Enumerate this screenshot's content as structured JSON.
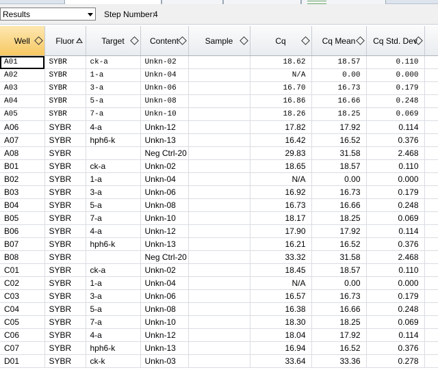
{
  "toolbar": {
    "view_selected": "Results",
    "step_label": "Step Number:",
    "step_value": "4"
  },
  "columns": [
    "Well",
    "Fluor",
    "Target",
    "Content",
    "Sample",
    "Cq",
    "Cq Mean",
    "Cq Std. Dev"
  ],
  "sorted_column": "Fluor",
  "rows": [
    {
      "well": "A01",
      "fluor": "SYBR",
      "target": "ck-a",
      "content": "Unkn-02",
      "sample": "",
      "cq": "18.62",
      "cq_mean": "18.57",
      "cq_std": "0.110"
    },
    {
      "well": "A02",
      "fluor": "SYBR",
      "target": "1-a",
      "content": "Unkn-04",
      "sample": "",
      "cq": "N/A",
      "cq_mean": "0.00",
      "cq_std": "0.000"
    },
    {
      "well": "A03",
      "fluor": "SYBR",
      "target": "3-a",
      "content": "Unkn-06",
      "sample": "",
      "cq": "16.70",
      "cq_mean": "16.73",
      "cq_std": "0.179"
    },
    {
      "well": "A04",
      "fluor": "SYBR",
      "target": "5-a",
      "content": "Unkn-08",
      "sample": "",
      "cq": "16.86",
      "cq_mean": "16.66",
      "cq_std": "0.248"
    },
    {
      "well": "A05",
      "fluor": "SYBR",
      "target": "7-a",
      "content": "Unkn-10",
      "sample": "",
      "cq": "18.26",
      "cq_mean": "18.25",
      "cq_std": "0.069"
    },
    {
      "well": "A06",
      "fluor": "SYBR",
      "target": "4-a",
      "content": "Unkn-12",
      "sample": "",
      "cq": "17.82",
      "cq_mean": "17.92",
      "cq_std": "0.114"
    },
    {
      "well": "A07",
      "fluor": "SYBR",
      "target": "hph6-k",
      "content": "Unkn-13",
      "sample": "",
      "cq": "16.42",
      "cq_mean": "16.52",
      "cq_std": "0.376"
    },
    {
      "well": "A08",
      "fluor": "SYBR",
      "target": "",
      "content": "Neg Ctrl-20",
      "sample": "",
      "cq": "29.83",
      "cq_mean": "31.58",
      "cq_std": "2.468"
    },
    {
      "well": "B01",
      "fluor": "SYBR",
      "target": "ck-a",
      "content": "Unkn-02",
      "sample": "",
      "cq": "18.65",
      "cq_mean": "18.57",
      "cq_std": "0.110"
    },
    {
      "well": "B02",
      "fluor": "SYBR",
      "target": "1-a",
      "content": "Unkn-04",
      "sample": "",
      "cq": "N/A",
      "cq_mean": "0.00",
      "cq_std": "0.000"
    },
    {
      "well": "B03",
      "fluor": "SYBR",
      "target": "3-a",
      "content": "Unkn-06",
      "sample": "",
      "cq": "16.92",
      "cq_mean": "16.73",
      "cq_std": "0.179"
    },
    {
      "well": "B04",
      "fluor": "SYBR",
      "target": "5-a",
      "content": "Unkn-08",
      "sample": "",
      "cq": "16.73",
      "cq_mean": "16.66",
      "cq_std": "0.248"
    },
    {
      "well": "B05",
      "fluor": "SYBR",
      "target": "7-a",
      "content": "Unkn-10",
      "sample": "",
      "cq": "18.17",
      "cq_mean": "18.25",
      "cq_std": "0.069"
    },
    {
      "well": "B06",
      "fluor": "SYBR",
      "target": "4-a",
      "content": "Unkn-12",
      "sample": "",
      "cq": "17.90",
      "cq_mean": "17.92",
      "cq_std": "0.114"
    },
    {
      "well": "B07",
      "fluor": "SYBR",
      "target": "hph6-k",
      "content": "Unkn-13",
      "sample": "",
      "cq": "16.21",
      "cq_mean": "16.52",
      "cq_std": "0.376"
    },
    {
      "well": "B08",
      "fluor": "SYBR",
      "target": "",
      "content": "Neg Ctrl-20",
      "sample": "",
      "cq": "33.32",
      "cq_mean": "31.58",
      "cq_std": "2.468"
    },
    {
      "well": "C01",
      "fluor": "SYBR",
      "target": "ck-a",
      "content": "Unkn-02",
      "sample": "",
      "cq": "18.45",
      "cq_mean": "18.57",
      "cq_std": "0.110"
    },
    {
      "well": "C02",
      "fluor": "SYBR",
      "target": "1-a",
      "content": "Unkn-04",
      "sample": "",
      "cq": "N/A",
      "cq_mean": "0.00",
      "cq_std": "0.000"
    },
    {
      "well": "C03",
      "fluor": "SYBR",
      "target": "3-a",
      "content": "Unkn-06",
      "sample": "",
      "cq": "16.57",
      "cq_mean": "16.73",
      "cq_std": "0.179"
    },
    {
      "well": "C04",
      "fluor": "SYBR",
      "target": "5-a",
      "content": "Unkn-08",
      "sample": "",
      "cq": "16.38",
      "cq_mean": "16.66",
      "cq_std": "0.248"
    },
    {
      "well": "C05",
      "fluor": "SYBR",
      "target": "7-a",
      "content": "Unkn-10",
      "sample": "",
      "cq": "18.30",
      "cq_mean": "18.25",
      "cq_std": "0.069"
    },
    {
      "well": "C06",
      "fluor": "SYBR",
      "target": "4-a",
      "content": "Unkn-12",
      "sample": "",
      "cq": "18.04",
      "cq_mean": "17.92",
      "cq_std": "0.114"
    },
    {
      "well": "C07",
      "fluor": "SYBR",
      "target": "hph6-k",
      "content": "Unkn-13",
      "sample": "",
      "cq": "16.94",
      "cq_mean": "16.52",
      "cq_std": "0.376"
    },
    {
      "well": "D01",
      "fluor": "SYBR",
      "target": "ck-k",
      "content": "Unkn-03",
      "sample": "",
      "cq": "33.64",
      "cq_mean": "33.36",
      "cq_std": "0.278"
    }
  ],
  "colors": {
    "sorted_header": "#f7c862",
    "header": "#e9ecf0",
    "grid_line": "#d9dce1"
  }
}
